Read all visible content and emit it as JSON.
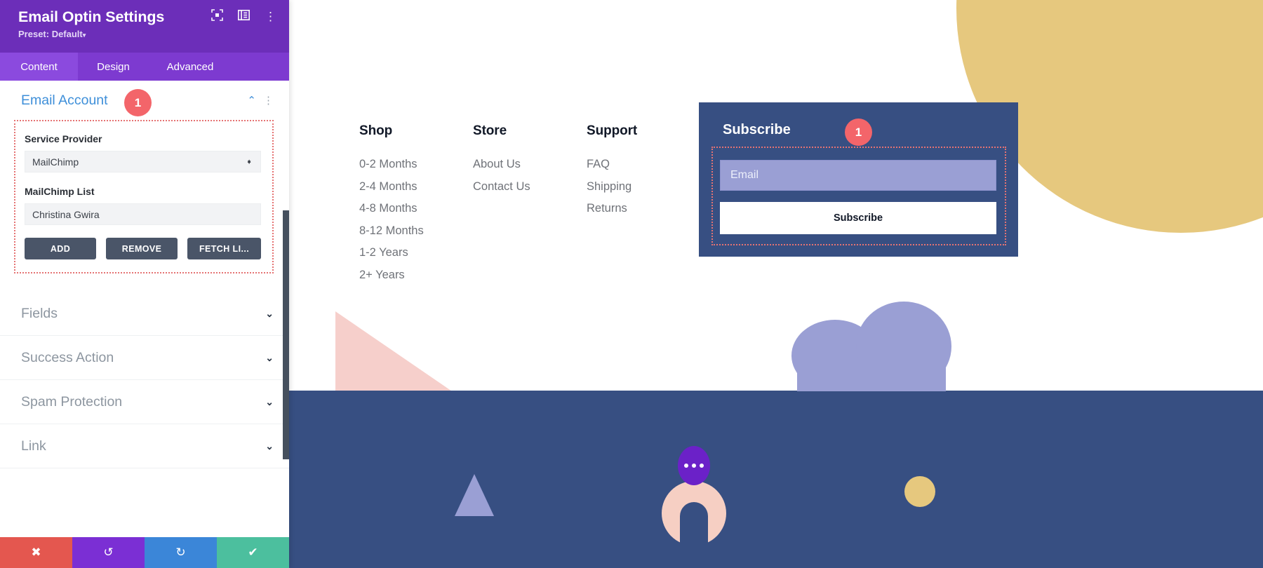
{
  "panel": {
    "title": "Email Optin Settings",
    "preset": "Preset: Default",
    "preset_caret": "▾",
    "header_icons": [
      {
        "name": "expand-icon"
      },
      {
        "name": "layout-icon"
      },
      {
        "name": "more-options-icon",
        "glyph": "⋮"
      }
    ],
    "tabs": [
      {
        "label": "Content",
        "active": true
      },
      {
        "label": "Design",
        "active": false
      },
      {
        "label": "Advanced",
        "active": false
      }
    ],
    "open_section": {
      "title": "Email Account",
      "badge": "1",
      "collapse_icon": "⌃",
      "kebab_icon": "⋮",
      "service_provider": {
        "label": "Service Provider",
        "value": "MailChimp"
      },
      "mailchimp_list": {
        "label": "MailChimp List",
        "value": "Christina Gwira"
      },
      "buttons": [
        {
          "label": "ADD"
        },
        {
          "label": "REMOVE"
        },
        {
          "label": "FETCH LI..."
        }
      ]
    },
    "collapsed_sections": [
      {
        "label": "Fields",
        "chevron": "⌄"
      },
      {
        "label": "Success Action",
        "chevron": "⌄"
      },
      {
        "label": "Spam Protection",
        "chevron": "⌄"
      },
      {
        "label": "Link",
        "chevron": "⌄"
      }
    ],
    "footer_buttons": [
      {
        "name": "cancel-button",
        "glyph": "✖",
        "color": "#e4574f"
      },
      {
        "name": "undo-button",
        "glyph": "↺",
        "color": "#7b2fd4"
      },
      {
        "name": "redo-button",
        "glyph": "↻",
        "color": "#3b86d8"
      },
      {
        "name": "save-button",
        "glyph": "✔",
        "color": "#4cbf9e"
      }
    ]
  },
  "preview": {
    "footer_columns": [
      {
        "heading": "Shop",
        "links": [
          "0-2 Months",
          "2-4 Months",
          "4-8 Months",
          "8-12 Months",
          "1-2 Years",
          "2+ Years"
        ]
      },
      {
        "heading": "Store",
        "links": [
          "About Us",
          "Contact Us"
        ]
      },
      {
        "heading": "Support",
        "links": [
          "FAQ",
          "Shipping",
          "Returns"
        ]
      }
    ],
    "subscribe_module": {
      "title": "Subscribe",
      "badge": "1",
      "email_placeholder": "Email",
      "button_label": "Subscribe"
    },
    "colors": {
      "module_background": "#374f82",
      "email_field": "#9a9fd4",
      "accent_yellow": "#e6c87e",
      "accent_pink": "#f6cfcb",
      "accent_purple": "#6b21c8",
      "badge_red": "#f3656a",
      "highlight_outline": "#e57373"
    }
  }
}
